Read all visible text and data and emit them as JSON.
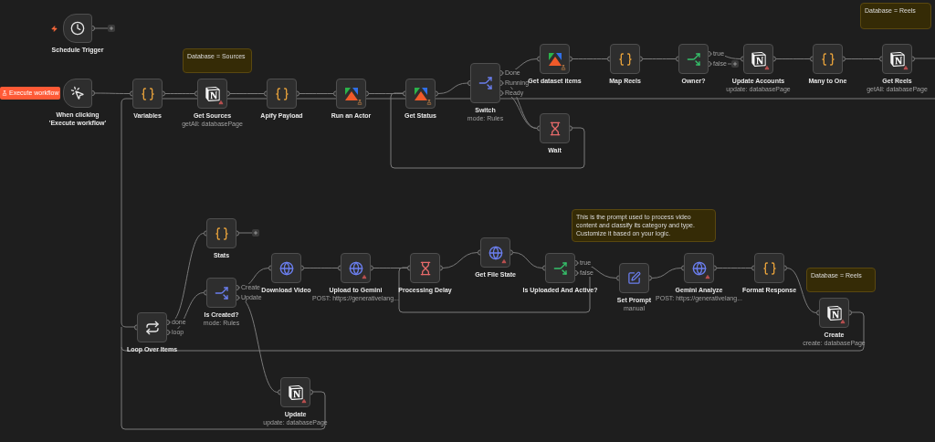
{
  "execute_button": "Execute workflow",
  "notes": [
    {
      "text": "Database = Sources"
    },
    {
      "text": "Database = Reels"
    },
    {
      "text": "This is the prompt used to process video content and classify its category and type. Customize it based on your logic."
    },
    {
      "text": "Database = Reels"
    }
  ],
  "nodes": [
    {
      "kind": "schedule",
      "label": "Schedule Trigger",
      "warning": false
    },
    {
      "kind": "manual",
      "label": "When clicking 'Execute workflow'",
      "warning": false
    },
    {
      "kind": "set",
      "label": "Variables",
      "warning": false
    },
    {
      "kind": "notion",
      "label": "Get Sources",
      "subtitle": "getAll: databasePage",
      "warning": true
    },
    {
      "kind": "set",
      "label": "Apify Payload",
      "warning": false
    },
    {
      "kind": "apify",
      "label": "Run an Actor",
      "warning": false
    },
    {
      "kind": "apify",
      "label": "Get Status",
      "warning": false
    },
    {
      "kind": "switch",
      "label": "Switch",
      "subtitle": "mode: Rules",
      "outputs": [
        "Done",
        "Running",
        "Ready"
      ],
      "warning": false
    },
    {
      "kind": "apify",
      "label": "Get dataset items",
      "warning": false
    },
    {
      "kind": "set",
      "label": "Map Reels",
      "warning": false
    },
    {
      "kind": "if",
      "label": "Owner?",
      "outputs": [
        "true",
        "false"
      ],
      "warning": false
    },
    {
      "kind": "notion",
      "label": "Update Accounts",
      "subtitle": "update: databasePage",
      "warning": true
    },
    {
      "kind": "set",
      "label": "Many to One",
      "warning": false
    },
    {
      "kind": "notion",
      "label": "Get Reels",
      "subtitle": "getAll: databasePage",
      "warning": true
    },
    {
      "kind": "wait",
      "label": "Wait",
      "warning": false
    },
    {
      "kind": "set",
      "label": "Stats",
      "warning": false
    },
    {
      "kind": "switch",
      "label": "Is Created?",
      "subtitle": "mode: Rules",
      "outputs": [
        "Create",
        "Update"
      ],
      "warning": false
    },
    {
      "kind": "loop",
      "label": "Loop Over Items",
      "outputs": [
        "done",
        "loop"
      ],
      "warning": false
    },
    {
      "kind": "http",
      "label": "Download Video",
      "warning": false
    },
    {
      "kind": "http",
      "label": "Upload to Gemini",
      "subtitle": "POST: https://generativelang...",
      "warning": true
    },
    {
      "kind": "wait",
      "label": "Processing Delay",
      "warning": false
    },
    {
      "kind": "http",
      "label": "Get File State",
      "warning": true
    },
    {
      "kind": "if",
      "label": "Is Uploaded And Active?",
      "outputs": [
        "true",
        "false"
      ],
      "warning": false
    },
    {
      "kind": "edit",
      "label": "Set Prompt",
      "subtitle": "manual",
      "warning": false
    },
    {
      "kind": "http",
      "label": "Gemini Analyze",
      "subtitle": "POST: https://generativelang...",
      "warning": true
    },
    {
      "kind": "set",
      "label": "Format Response",
      "warning": false
    },
    {
      "kind": "notion",
      "label": "Create",
      "subtitle": "create: databasePage",
      "warning": true
    },
    {
      "kind": "notion",
      "label": "Update",
      "subtitle": "update: databasePage",
      "warning": true
    }
  ]
}
